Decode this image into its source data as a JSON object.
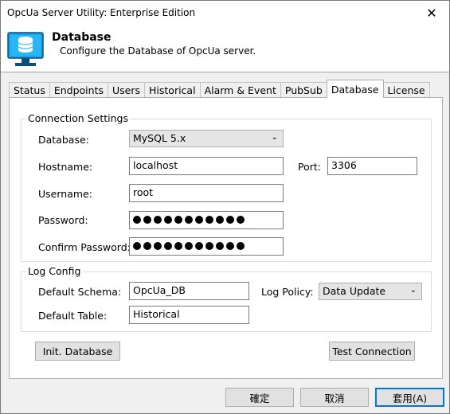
{
  "window": {
    "title": "OpcUa Server Utility: Enterprise Edition",
    "close_glyph": "✕"
  },
  "header": {
    "title": "Database",
    "description": "Configure the Database of OpcUa server."
  },
  "tabs": [
    "Status",
    "Endpoints",
    "Users",
    "Historical",
    "Alarm & Event",
    "PubSub",
    "Database",
    "License"
  ],
  "connection": {
    "group_title": "Connection Settings",
    "database_label": "Database:",
    "database_value": "MySQL 5.x",
    "hostname_label": "Hostname:",
    "hostname_value": "localhost",
    "port_label": "Port:",
    "port_value": "3306",
    "username_label": "Username:",
    "username_value": "root",
    "password_label": "Password:",
    "password_dot_count": 11,
    "confirm_label": "Confirm Password:",
    "confirm_dot_count": 11
  },
  "log": {
    "group_title": "Log Config",
    "schema_label": "Default Schema:",
    "schema_value": "OpcUa_DB",
    "table_label": "Default Table:",
    "table_value": "Historical",
    "policy_label": "Log Policy:",
    "policy_value": "Data Update"
  },
  "actions": {
    "init_label": "Init. Database",
    "test_label": "Test Connection"
  },
  "footer": {
    "ok_label": "確定",
    "cancel_label": "取消",
    "apply_label": "套用(A)"
  },
  "colors": {
    "accent": "#0078d7",
    "icon_blue": "#1ea0e8"
  }
}
